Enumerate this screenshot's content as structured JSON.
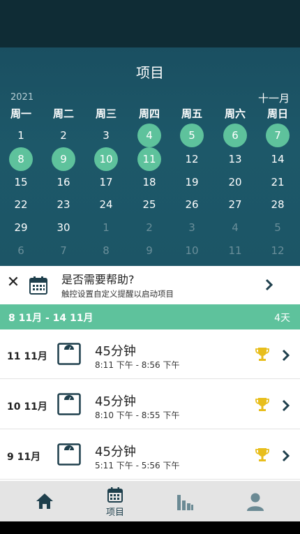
{
  "header": {
    "title": "项目",
    "year": "2021",
    "month": "十一月"
  },
  "calendar": {
    "weekdays": [
      "周一",
      "周二",
      "周三",
      "周四",
      "周五",
      "周六",
      "周日"
    ],
    "rows": [
      [
        {
          "d": "1"
        },
        {
          "d": "2"
        },
        {
          "d": "3"
        },
        {
          "d": "4",
          "hl": true
        },
        {
          "d": "5",
          "hl": true
        },
        {
          "d": "6",
          "hl": true
        },
        {
          "d": "7",
          "hl": true
        }
      ],
      [
        {
          "d": "8",
          "hl": true
        },
        {
          "d": "9",
          "hl": true
        },
        {
          "d": "10",
          "hl": true
        },
        {
          "d": "11",
          "hl": true
        },
        {
          "d": "12"
        },
        {
          "d": "13"
        },
        {
          "d": "14"
        }
      ],
      [
        {
          "d": "15"
        },
        {
          "d": "16"
        },
        {
          "d": "17"
        },
        {
          "d": "18"
        },
        {
          "d": "19"
        },
        {
          "d": "20"
        },
        {
          "d": "21"
        }
      ],
      [
        {
          "d": "22"
        },
        {
          "d": "23"
        },
        {
          "d": "24"
        },
        {
          "d": "25"
        },
        {
          "d": "26"
        },
        {
          "d": "27"
        },
        {
          "d": "28"
        }
      ],
      [
        {
          "d": "29"
        },
        {
          "d": "30"
        },
        {
          "d": "1",
          "muted": true
        },
        {
          "d": "2",
          "muted": true
        },
        {
          "d": "3",
          "muted": true
        },
        {
          "d": "4",
          "muted": true
        },
        {
          "d": "5",
          "muted": true
        }
      ],
      [
        {
          "d": "6",
          "muted": true
        },
        {
          "d": "7",
          "muted": true
        },
        {
          "d": "8",
          "muted": true
        },
        {
          "d": "9",
          "muted": true
        },
        {
          "d": "10",
          "muted": true
        },
        {
          "d": "11",
          "muted": true
        },
        {
          "d": "12",
          "muted": true
        }
      ]
    ]
  },
  "help": {
    "title": "是否需要帮助?",
    "subtitle": "触控设置自定义提醒以启动项目"
  },
  "week": {
    "range": "8 11月 - 14 11月",
    "days": "4天"
  },
  "sessions": [
    {
      "date": "11 11月",
      "duration": "45分钟",
      "time": "8:11 下午 - 8:56 下午"
    },
    {
      "date": "10 11月",
      "duration": "45分钟",
      "time": "8:10 下午 - 8:55 下午"
    },
    {
      "date": "9 11月",
      "duration": "45分钟",
      "time": "5:11 下午 - 5:56 下午"
    }
  ],
  "nav": {
    "items": [
      {
        "icon": "home-icon",
        "label": ""
      },
      {
        "icon": "calendar-icon",
        "label": "项目",
        "active": true
      },
      {
        "icon": "bar-chart-icon",
        "label": ""
      },
      {
        "icon": "person-icon",
        "label": ""
      }
    ]
  },
  "colors": {
    "header_bg": "#1d5869",
    "accent": "#5ec29c",
    "trophy": "#e8be1c",
    "status_bar": "#0f2c35"
  }
}
